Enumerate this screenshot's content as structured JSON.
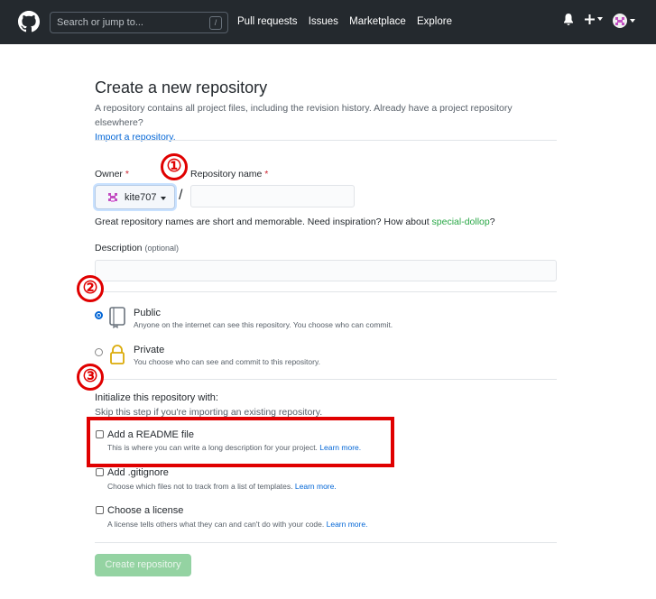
{
  "nav": {
    "search_placeholder": "Search or jump to...",
    "search_shortcut": "/",
    "links": [
      "Pull requests",
      "Issues",
      "Marketplace",
      "Explore"
    ]
  },
  "page": {
    "title": "Create a new repository",
    "subhead": "A repository contains all project files, including the revision history. Already have a project repository elsewhere?",
    "import_link": "Import a repository."
  },
  "owner": {
    "label": "Owner",
    "required_mark": "*",
    "username": "kite707"
  },
  "repo_name": {
    "label": "Repository name",
    "required_mark": "*",
    "value": ""
  },
  "separator": "/",
  "name_hint": {
    "text": "Great repository names are short and memorable. Need inspiration? How about ",
    "suggestion": "special-dollop",
    "suffix": "?"
  },
  "description": {
    "label": "Description",
    "optional": "(optional)",
    "value": ""
  },
  "visibility": {
    "public_title": "Public",
    "public_desc": "Anyone on the internet can see this repository. You choose who can commit.",
    "private_title": "Private",
    "private_desc": "You choose who can see and commit to this repository.",
    "selected": "public"
  },
  "init": {
    "title": "Initialize this repository with:",
    "subtitle": "Skip this step if you're importing an existing repository.",
    "readme_title": "Add a README file",
    "readme_desc": "This is where you can write a long description for your project.",
    "gitignore_title": "Add .gitignore",
    "gitignore_desc": "Choose which files not to track from a list of templates.",
    "license_title": "Choose a license",
    "license_desc": "A license tells others what they can and can't do with your code.",
    "learn_more": "Learn more."
  },
  "create_button": "Create repository",
  "annotations": {
    "marker1": "①",
    "marker2": "②",
    "marker3": "③"
  },
  "colors": {
    "nav_bg": "#24292e",
    "link": "#0366d6",
    "required": "#cb2431",
    "suggestion": "#28a745",
    "annotation": "#e00000",
    "create_button_bg": "#94d3a2"
  }
}
